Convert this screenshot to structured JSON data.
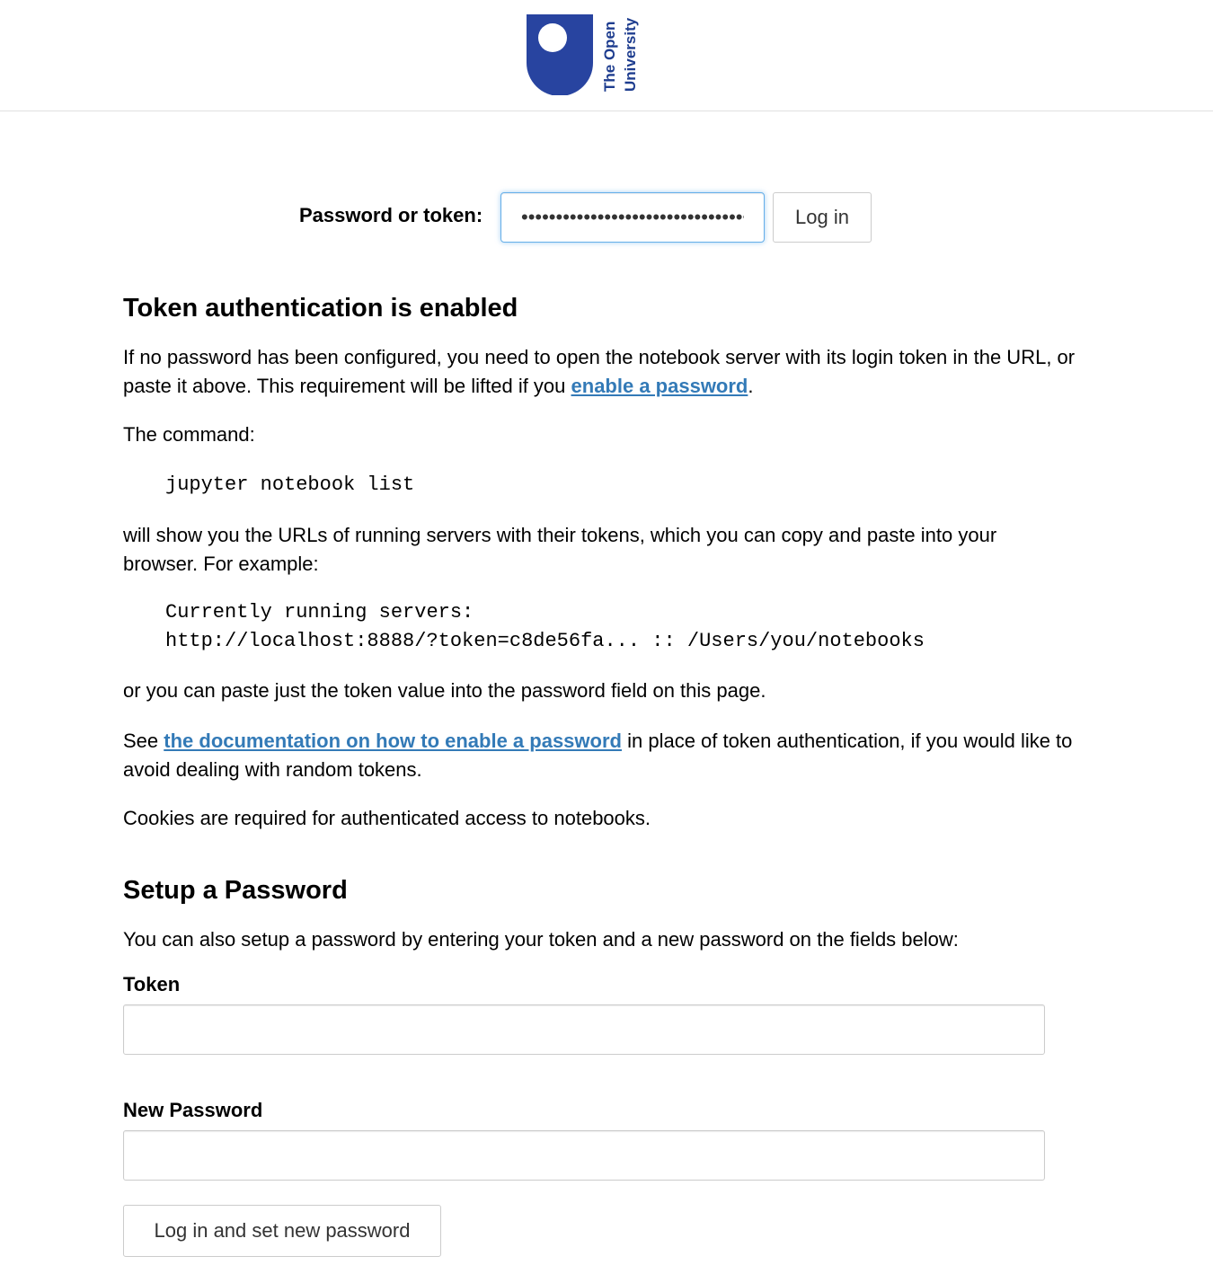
{
  "brand": {
    "logo_line1": "The Open",
    "logo_line2": "University",
    "color": "#2844a0"
  },
  "login": {
    "label": "Password or token:",
    "value": "••••••••••••••••••••••••••••••••••",
    "button": "Log in"
  },
  "token_section": {
    "heading": "Token authentication is enabled",
    "p1_before_link": "If no password has been configured, you need to open the notebook server with its login token in the URL, or paste it above. This requirement will be lifted if you ",
    "p1_link": "enable a password",
    "p1_after_link": ".",
    "p2": "The command:",
    "command": "jupyter notebook list",
    "p3": "will show you the URLs of running servers with their tokens, which you can copy and paste into your browser. For example:",
    "example_line1": "Currently running servers:",
    "example_line2": "http://localhost:8888/?token=c8de56fa... :: /Users/you/notebooks",
    "p4": "or you can paste just the token value into the password field on this page.",
    "p5_before_link": "See ",
    "p5_link": "the documentation on how to enable a password",
    "p5_after_link": " in place of token authentication, if you would like to avoid dealing with random tokens.",
    "p6": "Cookies are required for authenticated access to notebooks."
  },
  "setup_section": {
    "heading": "Setup a Password",
    "intro": "You can also setup a password by entering your token and a new password on the fields below:",
    "token_label": "Token",
    "token_value": "",
    "new_password_label": "New Password",
    "new_password_value": "",
    "submit_button": "Log in and set new password"
  },
  "colors": {
    "link": "#337ab7",
    "focus_border": "#66afe9",
    "border": "#cccccc"
  }
}
